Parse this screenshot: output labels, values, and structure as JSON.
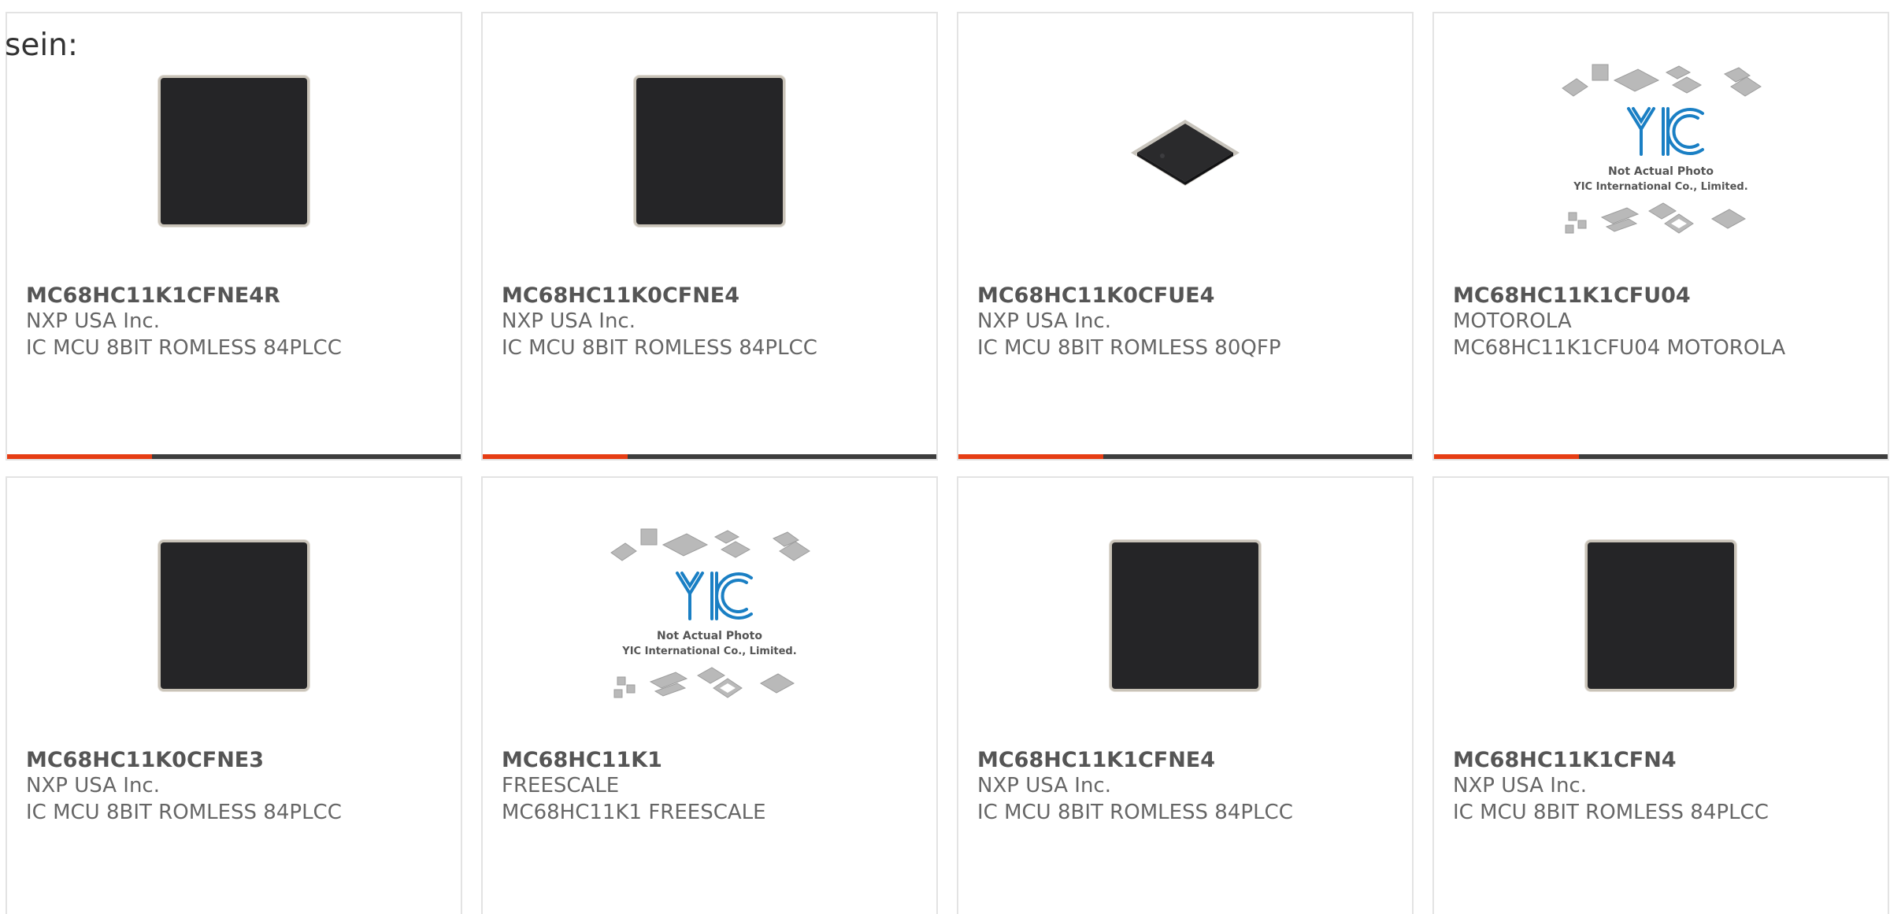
{
  "intro_text": "sein:",
  "colors": {
    "card_border": "#e3e3e3",
    "bar_accent": "#e63d14",
    "bar_base": "#3d3d3d",
    "title_text": "#555555",
    "body_text": "#666666",
    "logo_blue": "#1a7fc4"
  },
  "placeholder": {
    "line1": "Not Actual Photo",
    "line2": "YIC International Co., Limited.",
    "logo": "YIC"
  },
  "products": [
    {
      "part": "MC68HC11K1CFNE4R",
      "maker": "NXP USA Inc.",
      "description": "IC MCU 8BIT ROMLESS 84PLCC",
      "image": "plcc-chip-icon",
      "bar_fill": 0.32
    },
    {
      "part": "MC68HC11K0CFNE4",
      "maker": "NXP USA Inc.",
      "description": "IC MCU 8BIT ROMLESS 84PLCC",
      "image": "plcc-chip-icon",
      "bar_fill": 0.32
    },
    {
      "part": "MC68HC11K0CFUE4",
      "maker": "NXP USA Inc.",
      "description": "IC MCU 8BIT ROMLESS 80QFP",
      "image": "qfp-chip-icon",
      "bar_fill": 0.32
    },
    {
      "part": "MC68HC11K1CFU04",
      "maker": "MOTOROLA",
      "description": "MC68HC11K1CFU04 MOTOROLA",
      "image": "not-actual-photo-icon",
      "bar_fill": 0.32
    },
    {
      "part": "MC68HC11K0CFNE3",
      "maker": "NXP USA Inc.",
      "description": "IC MCU 8BIT ROMLESS 84PLCC",
      "image": "plcc-chip-icon",
      "bar_fill": 0.32
    },
    {
      "part": "MC68HC11K1",
      "maker": "FREESCALE",
      "description": "MC68HC11K1 FREESCALE",
      "image": "not-actual-photo-icon",
      "bar_fill": 0.32
    },
    {
      "part": "MC68HC11K1CFNE4",
      "maker": "NXP USA Inc.",
      "description": "IC MCU 8BIT ROMLESS 84PLCC",
      "image": "plcc-chip-icon",
      "bar_fill": 0.32
    },
    {
      "part": "MC68HC11K1CFN4",
      "maker": "NXP USA Inc.",
      "description": "IC MCU 8BIT ROMLESS 84PLCC",
      "image": "plcc-chip-icon",
      "bar_fill": 0.32
    }
  ]
}
